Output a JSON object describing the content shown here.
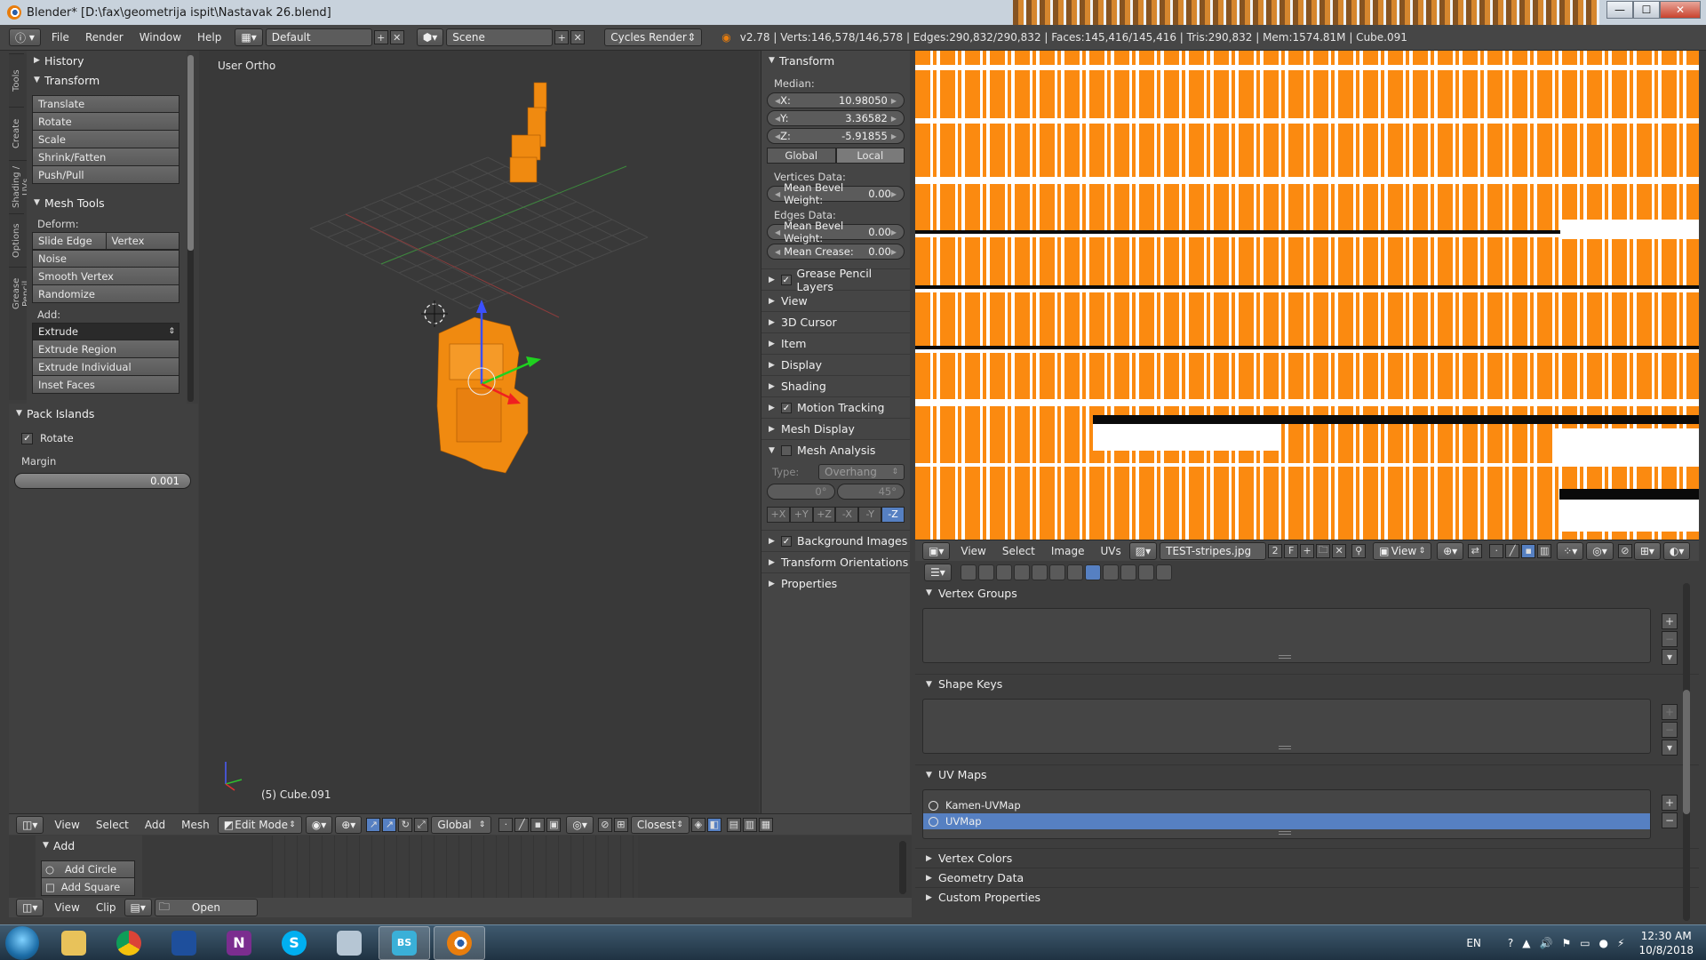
{
  "window": {
    "title": "Blender* [D:\\fax\\geometrija ispit\\Nastavak 26.blend]",
    "min": "—",
    "max": "☐",
    "close": "✕"
  },
  "top_menu": {
    "items": [
      "File",
      "Render",
      "Window",
      "Help"
    ],
    "layout": "Default",
    "scene": "Scene",
    "engine": "Cycles Render",
    "stats": "v2.78 | Verts:146,578/146,578 | Edges:290,832/290,832 | Faces:145,416/145,416 | Tris:290,832 | Mem:1574.81M | Cube.091"
  },
  "tool_tabs": [
    "Tools",
    "Create",
    "Shading / UVs",
    "Options",
    "Grease Pencil"
  ],
  "tool_shelf": {
    "history": "History",
    "transform": {
      "title": "Transform",
      "buttons": [
        "Translate",
        "Rotate",
        "Scale",
        "Shrink/Fatten",
        "Push/Pull"
      ]
    },
    "mesh_tools": {
      "title": "Mesh Tools",
      "deform_label": "Deform:",
      "slide_edge": "Slide Edge",
      "vertex": "Vertex",
      "deform_buttons": [
        "Noise",
        "Smooth Vertex",
        "Randomize"
      ],
      "add_label": "Add:",
      "extrude": "Extrude",
      "add_buttons": [
        "Extrude Region",
        "Extrude Individual",
        "Inset Faces"
      ]
    }
  },
  "operator": {
    "title": "Pack Islands",
    "rotate": "Rotate",
    "margin_label": "Margin",
    "margin_value": "0.001"
  },
  "viewport": {
    "view_label": "User Ortho",
    "object_label": "(5) Cube.091"
  },
  "npanel": {
    "transform": "Transform",
    "median": "Median:",
    "fields": [
      {
        "label": "X:",
        "value": "10.98050"
      },
      {
        "label": "Y:",
        "value": "3.36582"
      },
      {
        "label": "Z:",
        "value": "-5.91855"
      }
    ],
    "global": "Global",
    "local": "Local",
    "vertices_data": "Vertices Data:",
    "mean_bevel_weight_v": "Mean Bevel Weight:",
    "mean_bevel_weight_v_value": "0.00",
    "edges_data": "Edges Data:",
    "mean_bevel_weight_e": "Mean Bevel Weight:",
    "mean_bevel_weight_e_value": "0.00",
    "mean_crease": "Mean Crease:",
    "mean_crease_value": "0.00",
    "sections": [
      {
        "label": "Grease Pencil Layers",
        "check": true
      },
      {
        "label": "View",
        "check": false
      },
      {
        "label": "3D Cursor",
        "check": false
      },
      {
        "label": "Item",
        "check": false
      },
      {
        "label": "Display",
        "check": false
      },
      {
        "label": "Shading",
        "check": false
      },
      {
        "label": "Motion Tracking",
        "check": true
      },
      {
        "label": "Mesh Display",
        "check": false
      }
    ],
    "mesh_analysis": "Mesh Analysis",
    "type_label": "Type:",
    "type_value": "Overhang",
    "angle_min": "0°",
    "angle_max": "45°",
    "axes": [
      "+X",
      "+Y",
      "+Z",
      "-X",
      "-Y",
      "-Z"
    ],
    "sections2": [
      {
        "label": "Background Images",
        "check": true
      },
      {
        "label": "Transform Orientations",
        "check": false
      },
      {
        "label": "Properties",
        "check": false
      }
    ]
  },
  "vp_header": {
    "menus": [
      "View",
      "Select",
      "Add",
      "Mesh"
    ],
    "mode": "Edit Mode",
    "orientation": "Global",
    "snap": "Closest"
  },
  "timeline": {
    "panel_title": "Add",
    "add_circle": "Add Circle",
    "add_square": "Add Square",
    "menus": [
      "View",
      "Clip"
    ],
    "open": "Open"
  },
  "uv_header": {
    "menus": [
      "View",
      "Select",
      "Image",
      "UVs"
    ],
    "image_name": "TEST-stripes.jpg",
    "users": "2",
    "fake_user": "F",
    "view": "View"
  },
  "properties": {
    "vertex_groups": "Vertex Groups",
    "shape_keys": "Shape Keys",
    "uv_maps": "UV Maps",
    "uv_map_items": [
      "Kamen-UVMap",
      "UVMap"
    ],
    "vertex_colors": "Vertex Colors",
    "geometry_data": "Geometry Data",
    "custom_properties": "Custom Properties"
  },
  "taskbar": {
    "apps": [
      "folder-app",
      "chrome-app",
      "save-app",
      "onenote-app",
      "skype-app",
      "paint-app",
      "bs-app",
      "blender-app"
    ],
    "onenote_letter": "N",
    "skype_letter": "S",
    "bs_letter": "BS",
    "lang": "EN",
    "time": "12:30 AM",
    "date": "10/8/2018"
  }
}
